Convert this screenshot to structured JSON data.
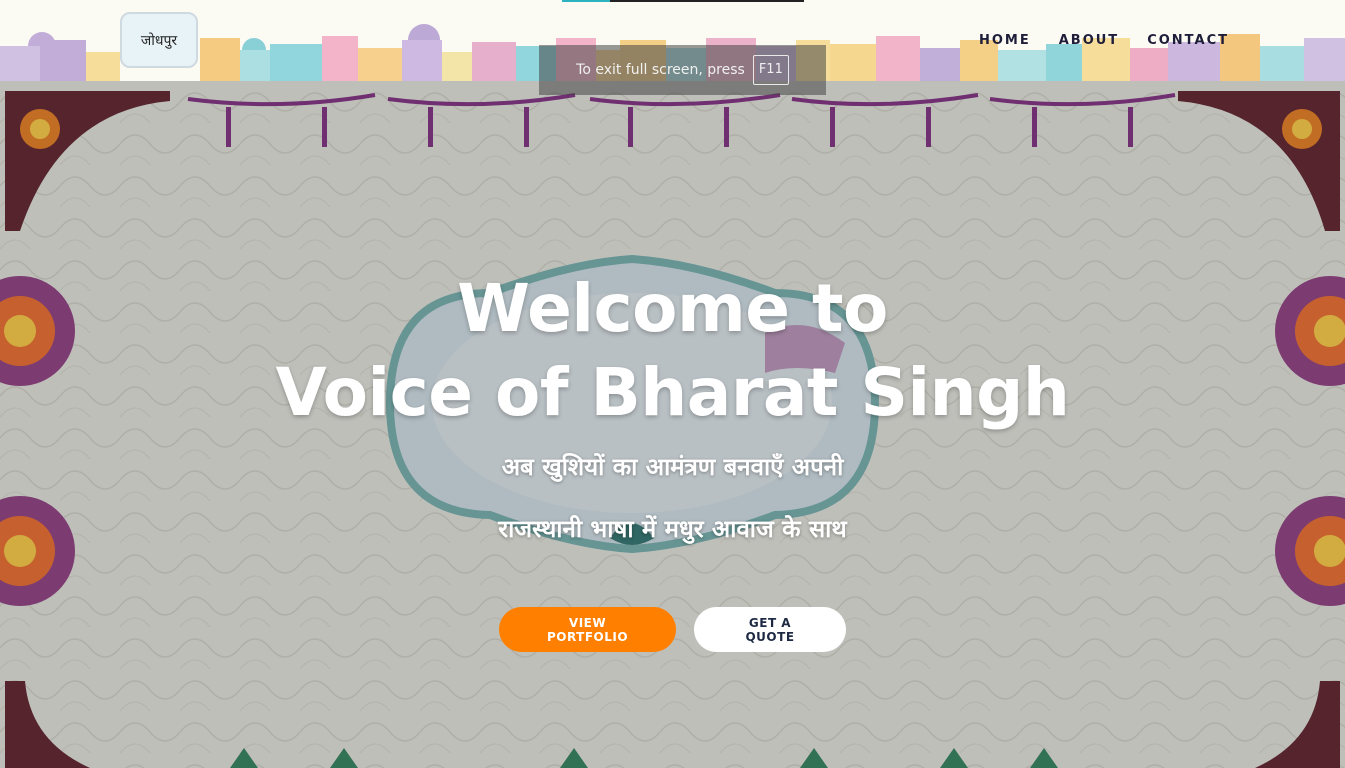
{
  "header": {
    "logo_text": "जोधपुर",
    "nav": [
      {
        "label": "HOME"
      },
      {
        "label": "ABOUT"
      },
      {
        "label": "CONTACT"
      }
    ]
  },
  "hero": {
    "title_line1": "Welcome to",
    "title_line2": "Voice of Bharat Singh",
    "subtitle_line1": "अब खुशियों का आमंत्रण बनवाएँ अपनी",
    "subtitle_line2": "राजस्थानी भाषा में मधुर आवाज के साथ",
    "primary_button": "VIEW PORTFOLIO",
    "secondary_button": "GET A QUOTE"
  },
  "toast": {
    "message": "To exit full screen, press",
    "key": "F11"
  },
  "colors": {
    "accent": "#ff8000",
    "nav_text": "#1e1e3a"
  }
}
